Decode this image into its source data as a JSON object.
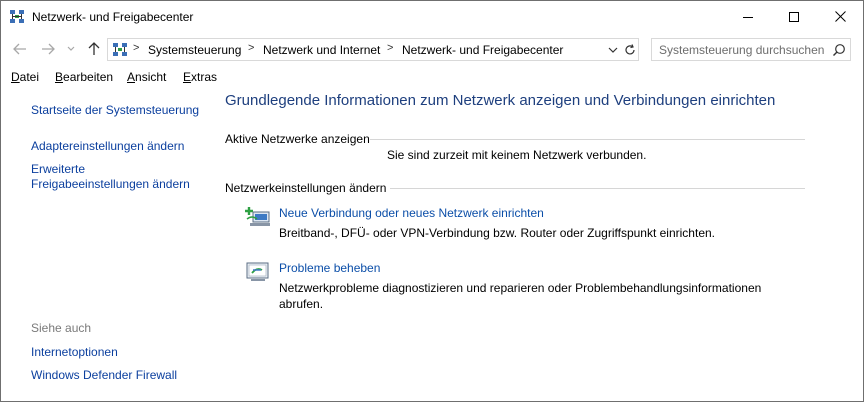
{
  "window": {
    "title": "Netzwerk- und Freigabecenter",
    "icon": "network-sharing-center-icon"
  },
  "address": {
    "breadcrumbs": [
      "Systemsteuerung",
      "Netzwerk und Internet",
      "Netzwerk- und Freigabecenter"
    ],
    "search_placeholder": "Systemsteuerung durchsuchen"
  },
  "menu": {
    "items": [
      {
        "first": "D",
        "rest": "atei"
      },
      {
        "first": "B",
        "rest": "earbeiten"
      },
      {
        "first": "A",
        "rest": "nsicht"
      },
      {
        "first": "E",
        "rest": "xtras"
      }
    ]
  },
  "sidebar": {
    "links": [
      "Startseite der Systemsteuerung",
      "Adaptereinstellungen ändern",
      "Erweiterte Freigabeeinstellungen ändern"
    ],
    "see_also_label": "Siehe auch",
    "see_also": [
      "Internetoptionen",
      "Windows Defender Firewall"
    ]
  },
  "main": {
    "title": "Grundlegende Informationen zum Netzwerk anzeigen und Verbindungen einrichten",
    "active_networks_label": "Aktive Netzwerke anzeigen",
    "no_network_text": "Sie sind zurzeit mit keinem Netzwerk verbunden.",
    "settings_label": "Netzwerkeinstellungen ändern",
    "tasks": [
      {
        "link": "Neue Verbindung oder neues Netzwerk einrichten",
        "desc": "Breitband-, DFÜ- oder VPN-Verbindung bzw. Router oder Zugriffspunkt einrichten.",
        "icon": "new-connection-icon"
      },
      {
        "link": "Probleme beheben",
        "desc": "Netzwerkprobleme diagnostizieren und reparieren oder Problembehandlungsinformationen abrufen.",
        "icon": "troubleshoot-icon"
      }
    ]
  },
  "colors": {
    "link": "#0b3f9e",
    "heading": "#1e3f7e",
    "muted": "#7a7a7a"
  }
}
